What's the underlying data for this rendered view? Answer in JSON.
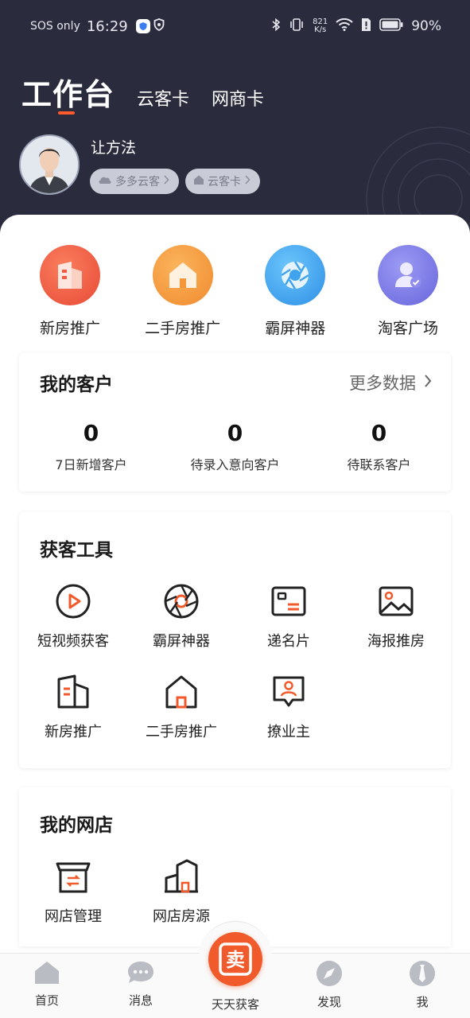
{
  "status_bar": {
    "carrier": "SOS only",
    "time": "16:29",
    "net_speed": "821",
    "net_unit": "K/s",
    "battery": "90%"
  },
  "header": {
    "tabs": [
      {
        "label": "工作台",
        "active": true
      },
      {
        "label": "云客卡",
        "active": false
      },
      {
        "label": "网商卡",
        "active": false
      }
    ],
    "user_name": "让方法",
    "chips": [
      {
        "label": "多多云客",
        "icon": "cloud-icon"
      },
      {
        "label": "云客卡",
        "icon": "house-icon"
      }
    ]
  },
  "quick_actions": [
    {
      "label": "新房推广",
      "icon": "building-icon",
      "color": "#f05b43"
    },
    {
      "label": "二手房推广",
      "icon": "home-icon",
      "color": "#f5973c"
    },
    {
      "label": "霸屏神器",
      "icon": "aperture-icon",
      "color": "#3fa3ee"
    },
    {
      "label": "淘客广场",
      "icon": "user-verified-icon",
      "color": "#7b79e6"
    }
  ],
  "customers": {
    "title": "我的客户",
    "more_label": "更多数据",
    "stats": [
      {
        "value": "0",
        "label": "7日新增客户"
      },
      {
        "value": "0",
        "label": "待录入意向客户"
      },
      {
        "value": "0",
        "label": "待联系客户"
      }
    ]
  },
  "tools": {
    "title": "获客工具",
    "items": [
      {
        "label": "短视频获客",
        "icon": "play-circle-icon"
      },
      {
        "label": "霸屏神器",
        "icon": "aperture-icon"
      },
      {
        "label": "递名片",
        "icon": "card-icon"
      },
      {
        "label": "海报推房",
        "icon": "image-icon"
      },
      {
        "label": "新房推广",
        "icon": "building-icon"
      },
      {
        "label": "二手房推广",
        "icon": "house-icon"
      },
      {
        "label": "撩业主",
        "icon": "chat-user-icon"
      }
    ]
  },
  "shop": {
    "title": "我的网店",
    "items": [
      {
        "label": "网店管理",
        "icon": "shop-icon"
      },
      {
        "label": "网店房源",
        "icon": "buildings-icon"
      }
    ]
  },
  "bottom_nav": {
    "items": [
      {
        "label": "首页",
        "icon": "home-icon"
      },
      {
        "label": "消息",
        "icon": "chat-icon"
      },
      {
        "label": "天天获客",
        "icon": "sell-icon",
        "center_glyph": "卖"
      },
      {
        "label": "发现",
        "icon": "compass-icon"
      },
      {
        "label": "我",
        "icon": "profile-icon"
      }
    ]
  },
  "colors": {
    "accent": "#f15a2b",
    "header_bg": "#2a2b3d"
  }
}
